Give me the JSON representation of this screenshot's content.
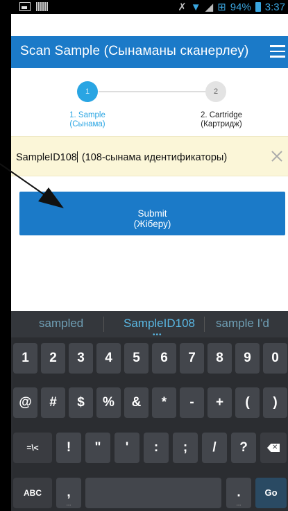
{
  "status_bar": {
    "battery": "94%",
    "time": "3:37"
  },
  "app_bar": {
    "title": "Scan Sample (Сынаманы сканерлеу)"
  },
  "stepper": {
    "steps": [
      {
        "number": "1",
        "label_line1": "1. Sample",
        "label_line2": "(Сынама)"
      },
      {
        "number": "2",
        "label_line1": "2. Cartridge",
        "label_line2": "(Картридж)"
      }
    ]
  },
  "input": {
    "value": "SampleID108",
    "hint": "(108-сынама идентификаторы)"
  },
  "submit": {
    "line1": "Submit",
    "line2": "(Жіберу)"
  },
  "keyboard": {
    "suggestions": [
      "sampled",
      "SampleID108",
      "sample I'd"
    ],
    "row1": [
      "1",
      "2",
      "3",
      "4",
      "5",
      "6",
      "7",
      "8",
      "9",
      "0"
    ],
    "row2": [
      "@",
      "#",
      "$",
      "%",
      "&",
      "*",
      "-",
      "+",
      "(",
      ")"
    ],
    "row3": [
      "=\\<",
      "!",
      "\"",
      "'",
      ":",
      ";",
      "/",
      "?"
    ],
    "row4": {
      "abc": "ABC",
      "comma": ",",
      "period": ".",
      "go": "Go"
    }
  },
  "colors": {
    "primary": "#1b7ac8",
    "step_active": "#29a5e3",
    "input_bg": "#fbf6d8"
  }
}
